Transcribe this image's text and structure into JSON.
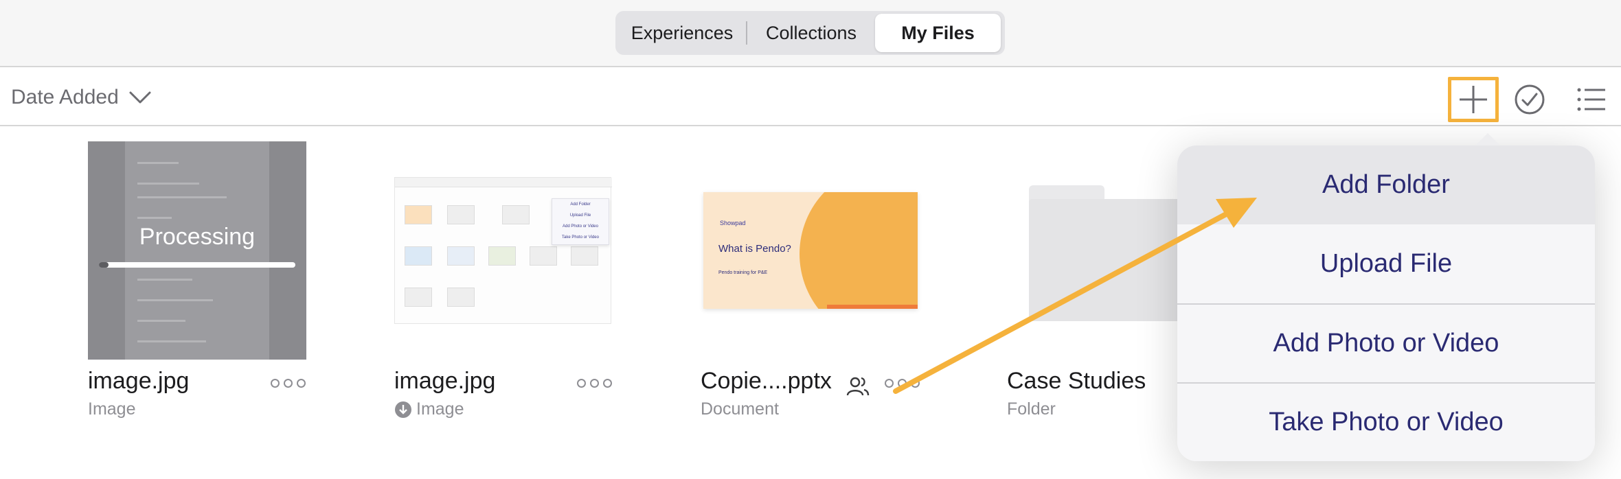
{
  "tabs": [
    {
      "label": "Experiences",
      "selected": false
    },
    {
      "label": "Collections",
      "selected": false
    },
    {
      "label": "My Files",
      "selected": true
    }
  ],
  "sort": {
    "label": "Date Added"
  },
  "toolbar": {
    "add_icon": "plus-icon",
    "select_icon": "checkmark-circle-icon",
    "list_icon": "list-view-icon",
    "highlight_color": "#f5b23c"
  },
  "files": [
    {
      "name": "image.jpg",
      "kind": "Image",
      "status": "Processing",
      "progress": 0.05
    },
    {
      "name": "image.jpg",
      "kind": "Image",
      "kind_icon": "download-icon"
    },
    {
      "name": "Copie....pptx",
      "kind": "Document",
      "shared_icon": "shared-users-icon"
    },
    {
      "name": "Case Studies",
      "kind": "Folder"
    }
  ],
  "mini_screenshot": {
    "menu": [
      "Add Folder",
      "Upload File",
      "Add Photo or Video",
      "Take Photo or Video"
    ]
  },
  "deck_preview": {
    "brand": "Showpad",
    "title": "What is Pendo?",
    "subtitle": "Pendo training for P&E"
  },
  "add_menu": {
    "items": [
      "Add Folder",
      "Upload File",
      "Add Photo or Video",
      "Take Photo or Video"
    ]
  },
  "colors": {
    "accent": "#f5b23c",
    "menu_text": "#2a2a72"
  }
}
